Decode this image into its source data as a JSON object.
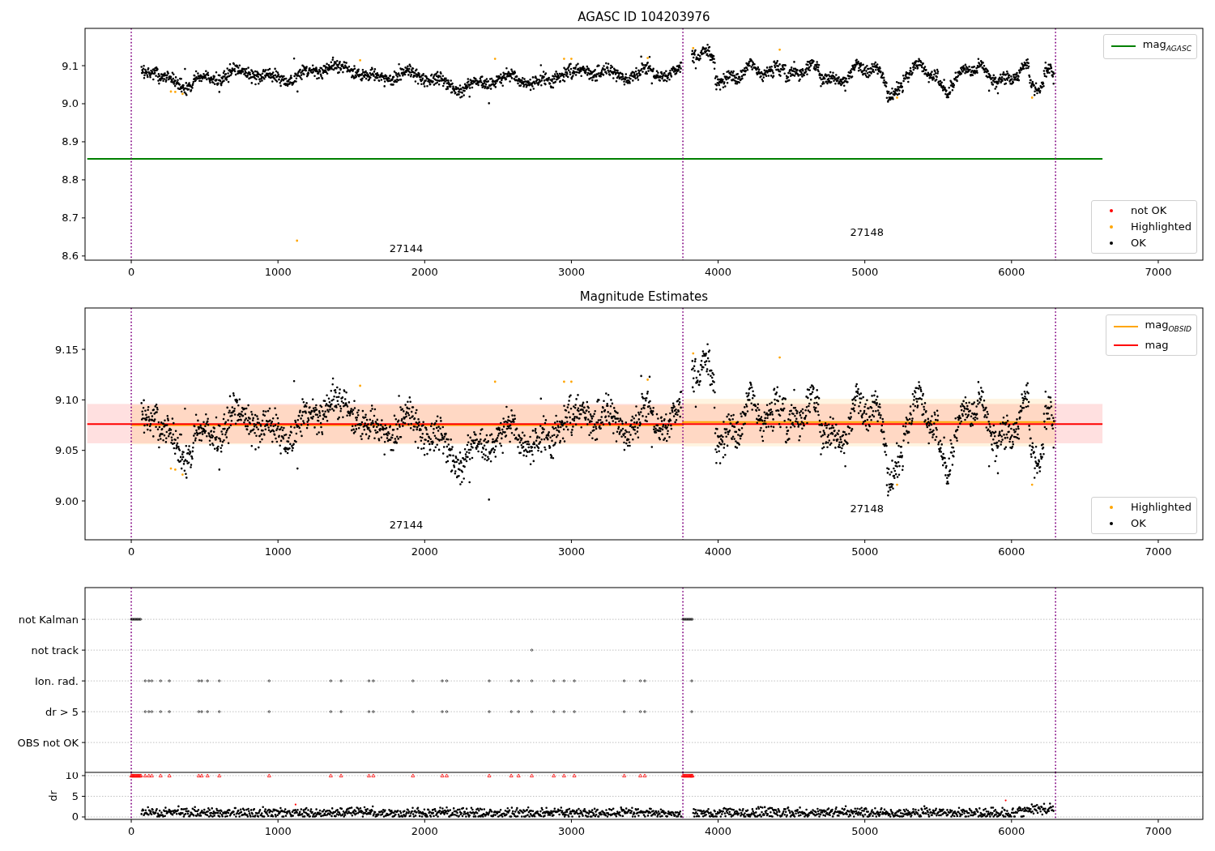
{
  "figure": {
    "panels": [
      {
        "title": "AGASC ID 104203976",
        "chart_data": {
          "type": "scatter",
          "xlim": [
            -315,
            7304
          ],
          "ylim": [
            8.589,
            9.198
          ],
          "xticks": [
            0,
            1000,
            2000,
            3000,
            4000,
            5000,
            6000,
            7000
          ],
          "yticks": [
            8.6,
            8.7,
            8.8,
            8.9,
            {
              "value": 9,
              "label": "9.0"
            },
            9.1
          ],
          "series": [
            {
              "name": "mag$_{AGASC}$",
              "type": "line",
              "color": "#008000",
              "x": [
                -300,
                6620
              ],
              "values": [
                8.855,
                8.855
              ]
            }
          ],
          "ref_lines": [
            {
              "axis": "x",
              "value": 0,
              "color": "#800080"
            },
            {
              "axis": "x",
              "value": 3760,
              "color": "#800080"
            },
            {
              "axis": "x",
              "value": 6300,
              "color": "#800080"
            }
          ],
          "annotations": [
            "27144",
            "27148"
          ]
        },
        "markers": [
          {
            "label": "not OK",
            "color": "#ff0000"
          },
          {
            "label": "Highlighted",
            "color": "#ffa500"
          },
          {
            "label": "OK",
            "color": "#000000"
          }
        ]
      },
      {
        "title": "Magnitude Estimates",
        "chart_data": {
          "type": "scatter",
          "xlim": [
            -315,
            7304
          ],
          "ylim": [
            8.9615,
            9.191
          ],
          "xticks": [
            0,
            1000,
            2000,
            3000,
            4000,
            5000,
            6000,
            7000
          ],
          "yticks": [
            {
              "value": 9,
              "label": "9.00"
            },
            {
              "value": 9.05,
              "label": "9.05"
            },
            {
              "value": 9.1,
              "label": "9.10"
            },
            {
              "value": 9.15,
              "label": "9.15"
            }
          ],
          "series": [
            {
              "name": "mag$_{OBSID}$",
              "type": "line",
              "color": "#ffa500",
              "x": [
                0,
                3760,
                3761,
                6300
              ],
              "values": [
                9.075,
                9.075,
                9.078,
                9.078
              ]
            },
            {
              "name": "mag",
              "type": "line",
              "color": "#ff0000",
              "x": [
                -300,
                6620
              ],
              "values": [
                9.076,
                9.076
              ]
            }
          ],
          "bands": [
            {
              "axis": "y",
              "from": 9.057,
              "to": 9.096,
              "color": "#ff0000"
            },
            {
              "axis": "y",
              "from": 9.056,
              "to": 9.095,
              "color": "#ffa500"
            },
            {
              "axis": "y",
              "from": 9.054,
              "to": 9.101,
              "color": "#ffa500"
            }
          ],
          "ref_lines": [
            {
              "axis": "x",
              "value": 0,
              "color": "#800080"
            },
            {
              "axis": "x",
              "value": 3760,
              "color": "#800080"
            },
            {
              "axis": "x",
              "value": 6300,
              "color": "#800080"
            }
          ],
          "annotations": [
            "27144",
            "27148"
          ]
        },
        "markers": [
          {
            "label": "Highlighted",
            "color": "#ffa500"
          },
          {
            "label": "OK",
            "color": "#000000"
          }
        ]
      }
    ],
    "flags": {
      "chart_data": {
        "type": "scatter",
        "orientation": "horizontal",
        "xlim": [
          -315,
          7304
        ],
        "categories": [
          "not Kalman",
          "not track",
          "Ion. rad.",
          "dr > 5",
          "OBS not OK"
        ],
        "grid": true,
        "ref_lines": [
          {
            "axis": "x",
            "value": 0,
            "color": "#800080"
          },
          {
            "axis": "x",
            "value": 3760,
            "color": "#800080"
          },
          {
            "axis": "x",
            "value": 6300,
            "color": "#800080"
          }
        ]
      }
    },
    "dr": {
      "chart_data": {
        "type": "scatter",
        "ylabel": "dr",
        "xlim": [
          -315,
          7304
        ],
        "ylim": [
          -0.59,
          10.78
        ],
        "xticks": [
          0,
          1000,
          2000,
          3000,
          4000,
          5000,
          6000,
          7000
        ],
        "yticks": [
          0,
          5,
          10
        ],
        "grid": true,
        "ref_lines": [
          {
            "axis": "x",
            "value": 0,
            "color": "#800080"
          },
          {
            "axis": "x",
            "value": 3760,
            "color": "#800080"
          },
          {
            "axis": "x",
            "value": 6300,
            "color": "#800080"
          }
        ]
      }
    }
  }
}
